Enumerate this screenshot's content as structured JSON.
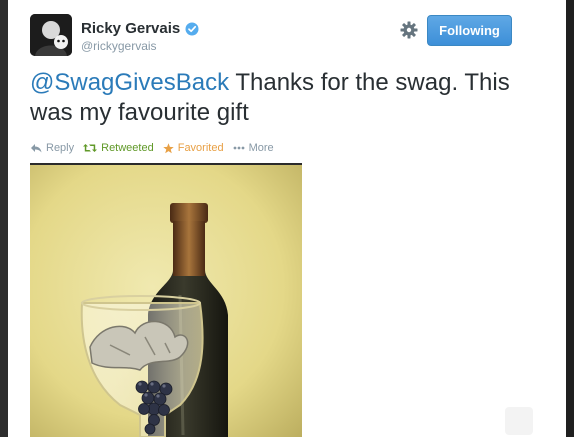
{
  "tweet": {
    "author_name": "Ricky Gervais",
    "author_handle": "@rickygervais",
    "follow_label": "Following",
    "mention": "@SwagGivesBack",
    "text": " Thanks for the swag. This was my favourite gift",
    "verified": true
  },
  "actions": {
    "reply": "Reply",
    "retweet": "Retweeted",
    "favorite": "Favorited",
    "more": "More"
  },
  "colors": {
    "link": "#2b7bb9",
    "retweeted": "#609928",
    "favorited": "#e8a045",
    "follow_button": "#3d8fd8"
  },
  "icons": {
    "reply": "reply-arrow-icon",
    "retweet": "retweet-icon",
    "favorite": "star-icon",
    "more": "ellipsis-icon",
    "settings": "gear-icon",
    "verified": "verified-badge-icon"
  }
}
